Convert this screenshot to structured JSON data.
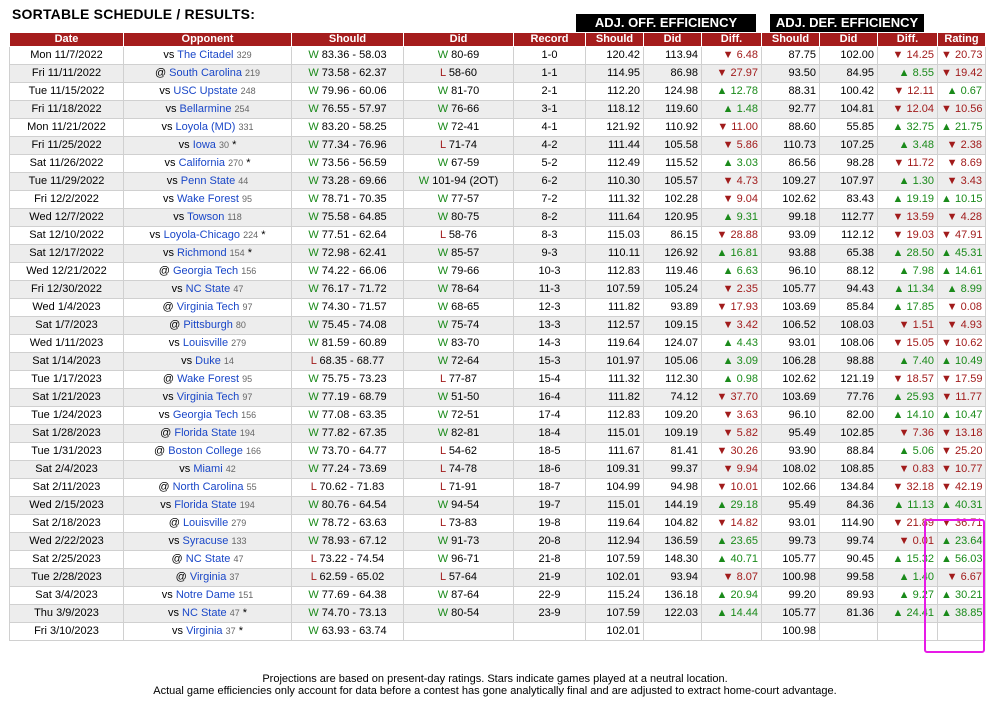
{
  "page": {
    "title": "SORTABLE SCHEDULE / RESULTS:"
  },
  "groups": {
    "off": "ADJ. OFF. EFFICIENCY",
    "def": "ADJ. DEF. EFFICIENCY"
  },
  "headers": [
    "Date",
    "Opponent",
    "Should",
    "Did",
    "Record",
    "Should",
    "Did",
    "Diff.",
    "Should",
    "Did",
    "Diff.",
    "Rating"
  ],
  "rows": [
    {
      "date": "Mon 11/7/2022",
      "loc": "vs",
      "opp": "The Citadel",
      "rank": "329",
      "star": "",
      "s_wl": "W",
      "s_score": "83.36 - 58.03",
      "d_wl": "W",
      "d_score": "80-69",
      "rec": "1-0",
      "os": "120.42",
      "od": "113.94",
      "odiff": "6.48",
      "odir": "dn",
      "ds": "87.75",
      "dd": "102.00",
      "ddiff": "14.25",
      "ddir": "dn",
      "rt": "20.73",
      "rdir": "dn"
    },
    {
      "date": "Fri 11/11/2022",
      "loc": "@",
      "opp": "South Carolina",
      "rank": "219",
      "star": "",
      "s_wl": "W",
      "s_score": "73.58 - 62.37",
      "d_wl": "L",
      "d_score": "58-60",
      "rec": "1-1",
      "os": "114.95",
      "od": "86.98",
      "odiff": "27.97",
      "odir": "dn",
      "ds": "93.50",
      "dd": "84.95",
      "ddiff": "8.55",
      "ddir": "up",
      "rt": "19.42",
      "rdir": "dn"
    },
    {
      "date": "Tue 11/15/2022",
      "loc": "vs",
      "opp": "USC Upstate",
      "rank": "248",
      "star": "",
      "s_wl": "W",
      "s_score": "79.96 - 60.06",
      "d_wl": "W",
      "d_score": "81-70",
      "rec": "2-1",
      "os": "112.20",
      "od": "124.98",
      "odiff": "12.78",
      "odir": "up",
      "ds": "88.31",
      "dd": "100.42",
      "ddiff": "12.11",
      "ddir": "dn",
      "rt": "0.67",
      "rdir": "up"
    },
    {
      "date": "Fri 11/18/2022",
      "loc": "vs",
      "opp": "Bellarmine",
      "rank": "254",
      "star": "",
      "s_wl": "W",
      "s_score": "76.55 - 57.97",
      "d_wl": "W",
      "d_score": "76-66",
      "rec": "3-1",
      "os": "118.12",
      "od": "119.60",
      "odiff": "1.48",
      "odir": "up",
      "ds": "92.77",
      "dd": "104.81",
      "ddiff": "12.04",
      "ddir": "dn",
      "rt": "10.56",
      "rdir": "dn"
    },
    {
      "date": "Mon 11/21/2022",
      "loc": "vs",
      "opp": "Loyola (MD)",
      "rank": "331",
      "star": "",
      "s_wl": "W",
      "s_score": "83.20 - 58.25",
      "d_wl": "W",
      "d_score": "72-41",
      "rec": "4-1",
      "os": "121.92",
      "od": "110.92",
      "odiff": "11.00",
      "odir": "dn",
      "ds": "88.60",
      "dd": "55.85",
      "ddiff": "32.75",
      "ddir": "up",
      "rt": "21.75",
      "rdir": "up"
    },
    {
      "date": "Fri 11/25/2022",
      "loc": "vs",
      "opp": "Iowa",
      "rank": "30",
      "star": "*",
      "s_wl": "W",
      "s_score": "77.34 - 76.96",
      "d_wl": "L",
      "d_score": "71-74",
      "rec": "4-2",
      "os": "111.44",
      "od": "105.58",
      "odiff": "5.86",
      "odir": "dn",
      "ds": "110.73",
      "dd": "107.25",
      "ddiff": "3.48",
      "ddir": "up",
      "rt": "2.38",
      "rdir": "dn"
    },
    {
      "date": "Sat 11/26/2022",
      "loc": "vs",
      "opp": "California",
      "rank": "270",
      "star": "*",
      "s_wl": "W",
      "s_score": "73.56 - 56.59",
      "d_wl": "W",
      "d_score": "67-59",
      "rec": "5-2",
      "os": "112.49",
      "od": "115.52",
      "odiff": "3.03",
      "odir": "up",
      "ds": "86.56",
      "dd": "98.28",
      "ddiff": "11.72",
      "ddir": "dn",
      "rt": "8.69",
      "rdir": "dn"
    },
    {
      "date": "Tue 11/29/2022",
      "loc": "vs",
      "opp": "Penn State",
      "rank": "44",
      "star": "",
      "s_wl": "W",
      "s_score": "73.28 - 69.66",
      "d_wl": "W",
      "d_score": "101-94 (2OT)",
      "rec": "6-2",
      "os": "110.30",
      "od": "105.57",
      "odiff": "4.73",
      "odir": "dn",
      "ds": "109.27",
      "dd": "107.97",
      "ddiff": "1.30",
      "ddir": "up",
      "rt": "3.43",
      "rdir": "dn"
    },
    {
      "date": "Fri 12/2/2022",
      "loc": "vs",
      "opp": "Wake Forest",
      "rank": "95",
      "star": "",
      "s_wl": "W",
      "s_score": "78.71 - 70.35",
      "d_wl": "W",
      "d_score": "77-57",
      "rec": "7-2",
      "os": "111.32",
      "od": "102.28",
      "odiff": "9.04",
      "odir": "dn",
      "ds": "102.62",
      "dd": "83.43",
      "ddiff": "19.19",
      "ddir": "up",
      "rt": "10.15",
      "rdir": "up"
    },
    {
      "date": "Wed 12/7/2022",
      "loc": "vs",
      "opp": "Towson",
      "rank": "118",
      "star": "",
      "s_wl": "W",
      "s_score": "75.58 - 64.85",
      "d_wl": "W",
      "d_score": "80-75",
      "rec": "8-2",
      "os": "111.64",
      "od": "120.95",
      "odiff": "9.31",
      "odir": "up",
      "ds": "99.18",
      "dd": "112.77",
      "ddiff": "13.59",
      "ddir": "dn",
      "rt": "4.28",
      "rdir": "dn"
    },
    {
      "date": "Sat 12/10/2022",
      "loc": "vs",
      "opp": "Loyola-Chicago",
      "rank": "224",
      "star": "*",
      "s_wl": "W",
      "s_score": "77.51 - 62.64",
      "d_wl": "L",
      "d_score": "58-76",
      "rec": "8-3",
      "os": "115.03",
      "od": "86.15",
      "odiff": "28.88",
      "odir": "dn",
      "ds": "93.09",
      "dd": "112.12",
      "ddiff": "19.03",
      "ddir": "dn",
      "rt": "47.91",
      "rdir": "dn"
    },
    {
      "date": "Sat 12/17/2022",
      "loc": "vs",
      "opp": "Richmond",
      "rank": "154",
      "star": "*",
      "s_wl": "W",
      "s_score": "72.98 - 62.41",
      "d_wl": "W",
      "d_score": "85-57",
      "rec": "9-3",
      "os": "110.11",
      "od": "126.92",
      "odiff": "16.81",
      "odir": "up",
      "ds": "93.88",
      "dd": "65.38",
      "ddiff": "28.50",
      "ddir": "up",
      "rt": "45.31",
      "rdir": "up"
    },
    {
      "date": "Wed 12/21/2022",
      "loc": "@",
      "opp": "Georgia Tech",
      "rank": "156",
      "star": "",
      "s_wl": "W",
      "s_score": "74.22 - 66.06",
      "d_wl": "W",
      "d_score": "79-66",
      "rec": "10-3",
      "os": "112.83",
      "od": "119.46",
      "odiff": "6.63",
      "odir": "up",
      "ds": "96.10",
      "dd": "88.12",
      "ddiff": "7.98",
      "ddir": "up",
      "rt": "14.61",
      "rdir": "up"
    },
    {
      "date": "Fri 12/30/2022",
      "loc": "vs",
      "opp": "NC State",
      "rank": "47",
      "star": "",
      "s_wl": "W",
      "s_score": "76.17 - 71.72",
      "d_wl": "W",
      "d_score": "78-64",
      "rec": "11-3",
      "os": "107.59",
      "od": "105.24",
      "odiff": "2.35",
      "odir": "dn",
      "ds": "105.77",
      "dd": "94.43",
      "ddiff": "11.34",
      "ddir": "up",
      "rt": "8.99",
      "rdir": "up"
    },
    {
      "date": "Wed 1/4/2023",
      "loc": "@",
      "opp": "Virginia Tech",
      "rank": "97",
      "star": "",
      "s_wl": "W",
      "s_score": "74.30 - 71.57",
      "d_wl": "W",
      "d_score": "68-65",
      "rec": "12-3",
      "os": "111.82",
      "od": "93.89",
      "odiff": "17.93",
      "odir": "dn",
      "ds": "103.69",
      "dd": "85.84",
      "ddiff": "17.85",
      "ddir": "up",
      "rt": "0.08",
      "rdir": "dn"
    },
    {
      "date": "Sat 1/7/2023",
      "loc": "@",
      "opp": "Pittsburgh",
      "rank": "80",
      "star": "",
      "s_wl": "W",
      "s_score": "75.45 - 74.08",
      "d_wl": "W",
      "d_score": "75-74",
      "rec": "13-3",
      "os": "112.57",
      "od": "109.15",
      "odiff": "3.42",
      "odir": "dn",
      "ds": "106.52",
      "dd": "108.03",
      "ddiff": "1.51",
      "ddir": "dn",
      "rt": "4.93",
      "rdir": "dn"
    },
    {
      "date": "Wed 1/11/2023",
      "loc": "vs",
      "opp": "Louisville",
      "rank": "279",
      "star": "",
      "s_wl": "W",
      "s_score": "81.59 - 60.89",
      "d_wl": "W",
      "d_score": "83-70",
      "rec": "14-3",
      "os": "119.64",
      "od": "124.07",
      "odiff": "4.43",
      "odir": "up",
      "ds": "93.01",
      "dd": "108.06",
      "ddiff": "15.05",
      "ddir": "dn",
      "rt": "10.62",
      "rdir": "dn"
    },
    {
      "date": "Sat 1/14/2023",
      "loc": "vs",
      "opp": "Duke",
      "rank": "14",
      "star": "",
      "s_wl": "L",
      "s_score": "68.35 - 68.77",
      "d_wl": "W",
      "d_score": "72-64",
      "rec": "15-3",
      "os": "101.97",
      "od": "105.06",
      "odiff": "3.09",
      "odir": "up",
      "ds": "106.28",
      "dd": "98.88",
      "ddiff": "7.40",
      "ddir": "up",
      "rt": "10.49",
      "rdir": "up"
    },
    {
      "date": "Tue 1/17/2023",
      "loc": "@",
      "opp": "Wake Forest",
      "rank": "95",
      "star": "",
      "s_wl": "W",
      "s_score": "75.75 - 73.23",
      "d_wl": "L",
      "d_score": "77-87",
      "rec": "15-4",
      "os": "111.32",
      "od": "112.30",
      "odiff": "0.98",
      "odir": "up",
      "ds": "102.62",
      "dd": "121.19",
      "ddiff": "18.57",
      "ddir": "dn",
      "rt": "17.59",
      "rdir": "dn"
    },
    {
      "date": "Sat 1/21/2023",
      "loc": "vs",
      "opp": "Virginia Tech",
      "rank": "97",
      "star": "",
      "s_wl": "W",
      "s_score": "77.19 - 68.79",
      "d_wl": "W",
      "d_score": "51-50",
      "rec": "16-4",
      "os": "111.82",
      "od": "74.12",
      "odiff": "37.70",
      "odir": "dn",
      "ds": "103.69",
      "dd": "77.76",
      "ddiff": "25.93",
      "ddir": "up",
      "rt": "11.77",
      "rdir": "dn"
    },
    {
      "date": "Tue 1/24/2023",
      "loc": "vs",
      "opp": "Georgia Tech",
      "rank": "156",
      "star": "",
      "s_wl": "W",
      "s_score": "77.08 - 63.35",
      "d_wl": "W",
      "d_score": "72-51",
      "rec": "17-4",
      "os": "112.83",
      "od": "109.20",
      "odiff": "3.63",
      "odir": "dn",
      "ds": "96.10",
      "dd": "82.00",
      "ddiff": "14.10",
      "ddir": "up",
      "rt": "10.47",
      "rdir": "up"
    },
    {
      "date": "Sat 1/28/2023",
      "loc": "@",
      "opp": "Florida State",
      "rank": "194",
      "star": "",
      "s_wl": "W",
      "s_score": "77.82 - 67.35",
      "d_wl": "W",
      "d_score": "82-81",
      "rec": "18-4",
      "os": "115.01",
      "od": "109.19",
      "odiff": "5.82",
      "odir": "dn",
      "ds": "95.49",
      "dd": "102.85",
      "ddiff": "7.36",
      "ddir": "dn",
      "rt": "13.18",
      "rdir": "dn"
    },
    {
      "date": "Tue 1/31/2023",
      "loc": "@",
      "opp": "Boston College",
      "rank": "166",
      "star": "",
      "s_wl": "W",
      "s_score": "73.70 - 64.77",
      "d_wl": "L",
      "d_score": "54-62",
      "rec": "18-5",
      "os": "111.67",
      "od": "81.41",
      "odiff": "30.26",
      "odir": "dn",
      "ds": "93.90",
      "dd": "88.84",
      "ddiff": "5.06",
      "ddir": "up",
      "rt": "25.20",
      "rdir": "dn"
    },
    {
      "date": "Sat 2/4/2023",
      "loc": "vs",
      "opp": "Miami",
      "rank": "42",
      "star": "",
      "s_wl": "W",
      "s_score": "77.24 - 73.69",
      "d_wl": "L",
      "d_score": "74-78",
      "rec": "18-6",
      "os": "109.31",
      "od": "99.37",
      "odiff": "9.94",
      "odir": "dn",
      "ds": "108.02",
      "dd": "108.85",
      "ddiff": "0.83",
      "ddir": "dn",
      "rt": "10.77",
      "rdir": "dn"
    },
    {
      "date": "Sat 2/11/2023",
      "loc": "@",
      "opp": "North Carolina",
      "rank": "55",
      "star": "",
      "s_wl": "L",
      "s_score": "70.62 - 71.83",
      "d_wl": "L",
      "d_score": "71-91",
      "rec": "18-7",
      "os": "104.99",
      "od": "94.98",
      "odiff": "10.01",
      "odir": "dn",
      "ds": "102.66",
      "dd": "134.84",
      "ddiff": "32.18",
      "ddir": "dn",
      "rt": "42.19",
      "rdir": "dn"
    },
    {
      "date": "Wed 2/15/2023",
      "loc": "vs",
      "opp": "Florida State",
      "rank": "194",
      "star": "",
      "s_wl": "W",
      "s_score": "80.76 - 64.54",
      "d_wl": "W",
      "d_score": "94-54",
      "rec": "19-7",
      "os": "115.01",
      "od": "144.19",
      "odiff": "29.18",
      "odir": "up",
      "ds": "95.49",
      "dd": "84.36",
      "ddiff": "11.13",
      "ddir": "up",
      "rt": "40.31",
      "rdir": "up"
    },
    {
      "date": "Sat 2/18/2023",
      "loc": "@",
      "opp": "Louisville",
      "rank": "279",
      "star": "",
      "s_wl": "W",
      "s_score": "78.72 - 63.63",
      "d_wl": "L",
      "d_score": "73-83",
      "rec": "19-8",
      "os": "119.64",
      "od": "104.82",
      "odiff": "14.82",
      "odir": "dn",
      "ds": "93.01",
      "dd": "114.90",
      "ddiff": "21.89",
      "ddir": "dn",
      "rt": "36.71",
      "rdir": "dn"
    },
    {
      "date": "Wed 2/22/2023",
      "loc": "vs",
      "opp": "Syracuse",
      "rank": "133",
      "star": "",
      "s_wl": "W",
      "s_score": "78.93 - 67.12",
      "d_wl": "W",
      "d_score": "91-73",
      "rec": "20-8",
      "os": "112.94",
      "od": "136.59",
      "odiff": "23.65",
      "odir": "up",
      "ds": "99.73",
      "dd": "99.74",
      "ddiff": "0.01",
      "ddir": "dn",
      "rt": "23.64",
      "rdir": "up"
    },
    {
      "date": "Sat 2/25/2023",
      "loc": "@",
      "opp": "NC State",
      "rank": "47",
      "star": "",
      "s_wl": "L",
      "s_score": "73.22 - 74.54",
      "d_wl": "W",
      "d_score": "96-71",
      "rec": "21-8",
      "os": "107.59",
      "od": "148.30",
      "odiff": "40.71",
      "odir": "up",
      "ds": "105.77",
      "dd": "90.45",
      "ddiff": "15.32",
      "ddir": "up",
      "rt": "56.03",
      "rdir": "up"
    },
    {
      "date": "Tue 2/28/2023",
      "loc": "@",
      "opp": "Virginia",
      "rank": "37",
      "star": "",
      "s_wl": "L",
      "s_score": "62.59 - 65.02",
      "d_wl": "L",
      "d_score": "57-64",
      "rec": "21-9",
      "os": "102.01",
      "od": "93.94",
      "odiff": "8.07",
      "odir": "dn",
      "ds": "100.98",
      "dd": "99.58",
      "ddiff": "1.40",
      "ddir": "up",
      "rt": "6.67",
      "rdir": "dn"
    },
    {
      "date": "Sat 3/4/2023",
      "loc": "vs",
      "opp": "Notre Dame",
      "rank": "151",
      "star": "",
      "s_wl": "W",
      "s_score": "77.69 - 64.38",
      "d_wl": "W",
      "d_score": "87-64",
      "rec": "22-9",
      "os": "115.24",
      "od": "136.18",
      "odiff": "20.94",
      "odir": "up",
      "ds": "99.20",
      "dd": "89.93",
      "ddiff": "9.27",
      "ddir": "up",
      "rt": "30.21",
      "rdir": "up"
    },
    {
      "date": "Thu 3/9/2023",
      "loc": "vs",
      "opp": "NC State",
      "rank": "47",
      "star": "*",
      "s_wl": "W",
      "s_score": "74.70 - 73.13",
      "d_wl": "W",
      "d_score": "80-54",
      "rec": "23-9",
      "os": "107.59",
      "od": "122.03",
      "odiff": "14.44",
      "odir": "up",
      "ds": "105.77",
      "dd": "81.36",
      "ddiff": "24.41",
      "ddir": "up",
      "rt": "38.85",
      "rdir": "up"
    },
    {
      "date": "Fri 3/10/2023",
      "loc": "vs",
      "opp": "Virginia",
      "rank": "37",
      "star": "*",
      "s_wl": "W",
      "s_score": "63.93 - 63.74",
      "d_wl": "",
      "d_score": "",
      "rec": "",
      "os": "102.01",
      "od": "",
      "odiff": "",
      "odir": "",
      "ds": "100.98",
      "dd": "",
      "ddiff": "",
      "ddir": "",
      "rt": "",
      "rdir": ""
    }
  ],
  "footer": {
    "line1": "Projections are based on present-day ratings. Stars indicate games played at a neutral location.",
    "line2": "Actual game efficiencies only account for data before a contest has gone analytically final and are adjusted to extract home-court advantage."
  },
  "colors": {
    "header": "#a51d1d",
    "win": "#1a8a1a",
    "loss": "#a11b1b",
    "link": "#1a47c8",
    "highlight": "#e71ae7"
  }
}
